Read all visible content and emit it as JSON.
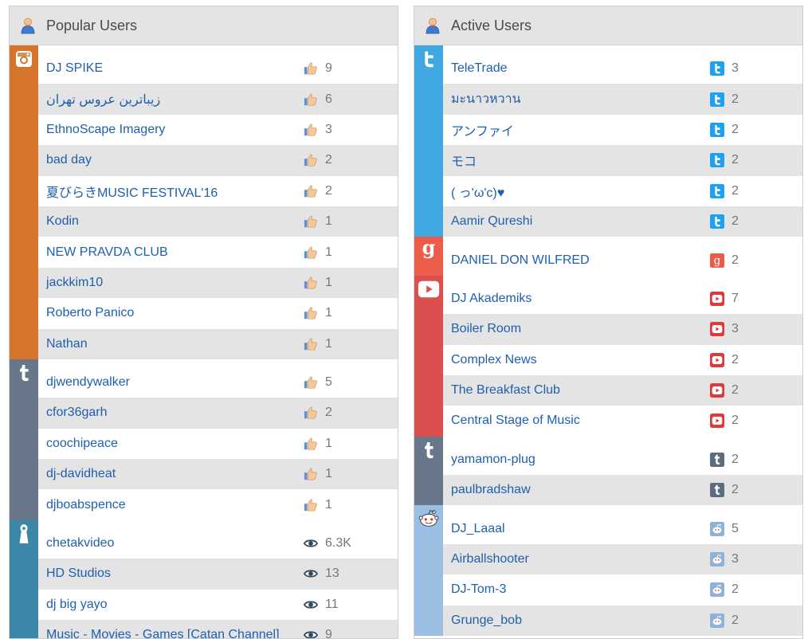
{
  "popular": {
    "title": "Popular Users",
    "groups": [
      {
        "network": "instagram",
        "color": "#d5742a",
        "metric_icon": "thumbs-up-icon",
        "rows": [
          {
            "name": "DJ SPIKE",
            "count": "9"
          },
          {
            "name": "زیباترین عروس تهران",
            "count": "6"
          },
          {
            "name": "EthnoScape Imagery",
            "count": "3"
          },
          {
            "name": "bad day",
            "count": "2"
          },
          {
            "name": "夏びらきMUSIC FESTIVAL'16",
            "count": "2"
          },
          {
            "name": "Kodin",
            "count": "1"
          },
          {
            "name": "NEW PRAVDA CLUB",
            "count": "1"
          },
          {
            "name": "jackkim10",
            "count": "1"
          },
          {
            "name": "Roberto Panico",
            "count": "1"
          },
          {
            "name": "Nathan",
            "count": "1"
          }
        ]
      },
      {
        "network": "tumblr",
        "color": "#69778a",
        "metric_icon": "thumbs-up-icon",
        "rows": [
          {
            "name": "djwendywalker",
            "count": "5"
          },
          {
            "name": "cfor36garh",
            "count": "2"
          },
          {
            "name": "coochipeace",
            "count": "1"
          },
          {
            "name": "dj-davidheat",
            "count": "1"
          },
          {
            "name": "djboabspence",
            "count": "1"
          }
        ]
      },
      {
        "network": "periscope",
        "color": "#3b87a8",
        "metric_icon": "eye-icon",
        "rows": [
          {
            "name": "chetakvideo",
            "count": "6.3K"
          },
          {
            "name": "HD Studios",
            "count": "13"
          },
          {
            "name": "dj big yayo",
            "count": "11"
          },
          {
            "name": "Music - Movies - Games [Catan Channel]",
            "count": "9"
          }
        ]
      }
    ]
  },
  "active": {
    "title": "Active Users",
    "groups": [
      {
        "network": "twitter",
        "color": "#3fa8e0",
        "metric_icon": "twitter-small-icon",
        "metric_color": "#1da1f2",
        "rows": [
          {
            "name": "TeleTrade",
            "count": "3"
          },
          {
            "name": "มะนาวหวาน",
            "count": "2"
          },
          {
            "name": "アンファイ",
            "count": "2"
          },
          {
            "name": "モコ",
            "count": "2"
          },
          {
            "name": "( っ'ω'c)♥",
            "count": "2"
          },
          {
            "name": "Aamir Qureshi",
            "count": "2"
          }
        ]
      },
      {
        "network": "googleplus",
        "color": "#ec5c4b",
        "metric_icon": "googleplus-small-icon",
        "metric_color": "#ec5c4b",
        "rows": [
          {
            "name": "DANIEL DON WILFRED",
            "count": "2"
          }
        ]
      },
      {
        "network": "youtube",
        "color": "#dc4f4f",
        "metric_icon": "youtube-small-icon",
        "metric_color": "#dd3b3b",
        "rows": [
          {
            "name": "DJ Akademiks",
            "count": "7"
          },
          {
            "name": "Boiler Room",
            "count": "3"
          },
          {
            "name": "Complex News",
            "count": "2"
          },
          {
            "name": "The Breakfast Club",
            "count": "2"
          },
          {
            "name": "Central Stage of Music",
            "count": "2"
          }
        ]
      },
      {
        "network": "tumblr",
        "color": "#69778a",
        "metric_icon": "tumblr-small-icon",
        "metric_color": "#5d6b7f",
        "rows": [
          {
            "name": "yamamon-plug",
            "count": "2"
          },
          {
            "name": "paulbradshaw",
            "count": "2"
          }
        ]
      },
      {
        "network": "reddit",
        "color": "#9bbfe2",
        "metric_icon": "reddit-small-icon",
        "metric_color": "#8fb3d8",
        "rows": [
          {
            "name": "DJ_Laaal",
            "count": "5"
          },
          {
            "name": "Airballshooter",
            "count": "3"
          },
          {
            "name": "DJ-Tom-3",
            "count": "2"
          },
          {
            "name": "Grunge_bob",
            "count": "2"
          }
        ]
      }
    ]
  }
}
